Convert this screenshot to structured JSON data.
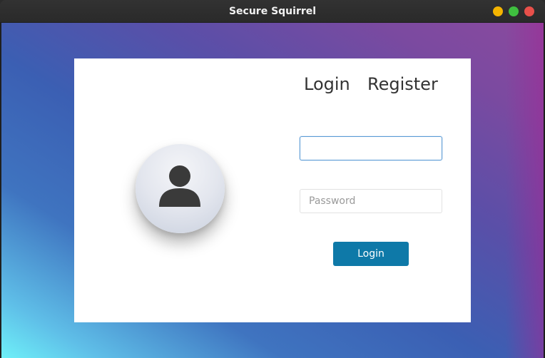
{
  "window": {
    "title": "Secure Squirrel",
    "controls": {
      "minimize_color": "#f4b400",
      "maximize_color": "#3fbf3f",
      "close_color": "#e8504a"
    }
  },
  "login_panel": {
    "tabs": [
      {
        "label": "Login"
      },
      {
        "label": "Register"
      }
    ],
    "avatar_icon": "user-silhouette-icon",
    "username_field": {
      "value": "",
      "placeholder": ""
    },
    "password_field": {
      "value": "",
      "placeholder": "Password"
    },
    "login_button": {
      "label": "Login",
      "color": "#0e79a8"
    }
  }
}
